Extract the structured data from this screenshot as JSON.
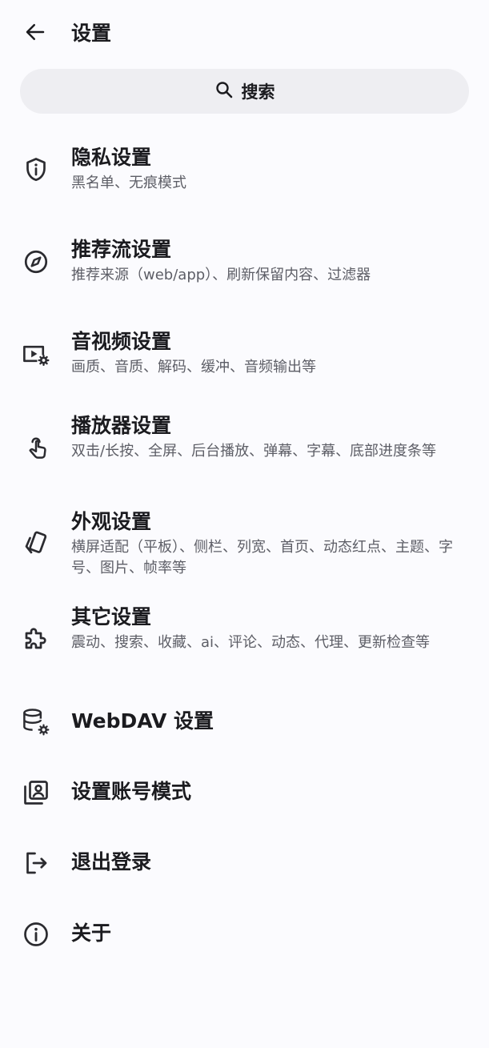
{
  "header": {
    "back_icon": "arrow-back-icon",
    "title": "设置"
  },
  "search": {
    "icon": "search-icon",
    "label": "搜索"
  },
  "items": [
    {
      "icon": "shield-info-icon",
      "title": "隐私设置",
      "subtitle": "黑名单、无痕模式"
    },
    {
      "icon": "compass-icon",
      "title": "推荐流设置",
      "subtitle": "推荐来源（web/app）、刷新保留内容、过滤器"
    },
    {
      "icon": "video-settings-icon",
      "title": "音视频设置",
      "subtitle": "画质、音质、解码、缓冲、音频输出等"
    },
    {
      "icon": "touch-app-icon",
      "title": "播放器设置",
      "subtitle": "双击/长按、全屏、后台播放、弹幕、字幕、底部进度条等"
    },
    {
      "icon": "cards-icon",
      "title": "外观设置",
      "subtitle": "横屏适配（平板）、侧栏、列宽、首页、动态红点、主题、字号、图片、帧率等"
    },
    {
      "icon": "extension-icon",
      "title": "其它设置",
      "subtitle": "震动、搜索、收藏、ai、评论、动态、代理、更新检查等"
    },
    {
      "icon": "database-settings-icon",
      "title": "WebDAV 设置"
    },
    {
      "icon": "account-box-icon",
      "title": "设置账号模式"
    },
    {
      "icon": "logout-icon",
      "title": "退出登录"
    },
    {
      "icon": "info-icon",
      "title": "关于"
    }
  ],
  "colors": {
    "background": "#fbfbfe",
    "search_background": "#eeeef2",
    "text_primary": "#1b1b1f",
    "text_secondary": "#5d5e66"
  }
}
